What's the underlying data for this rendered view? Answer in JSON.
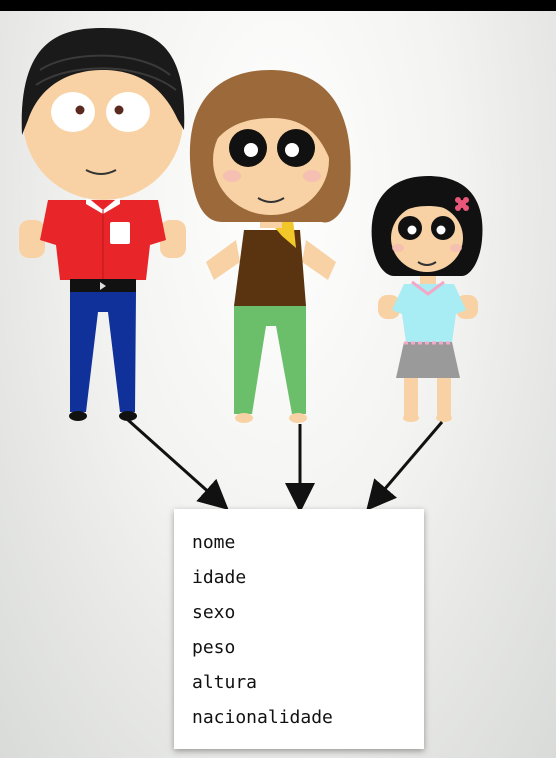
{
  "colors": {
    "father_shirt": "#e8262a",
    "father_pants": "#10309a",
    "mother_hair": "#9c6a3a",
    "mother_top": "#5a3410",
    "mother_pants": "#6cbf6a",
    "daughter_top": "#a8ecf4",
    "daughter_skirt": "#9a9a9a",
    "skin": "#f8d2a4",
    "arrow": "#111111"
  },
  "figures": [
    "father",
    "mother",
    "daughter"
  ],
  "attributes": [
    "nome",
    "idade",
    "sexo",
    "peso",
    "altura",
    "nacionalidade"
  ]
}
